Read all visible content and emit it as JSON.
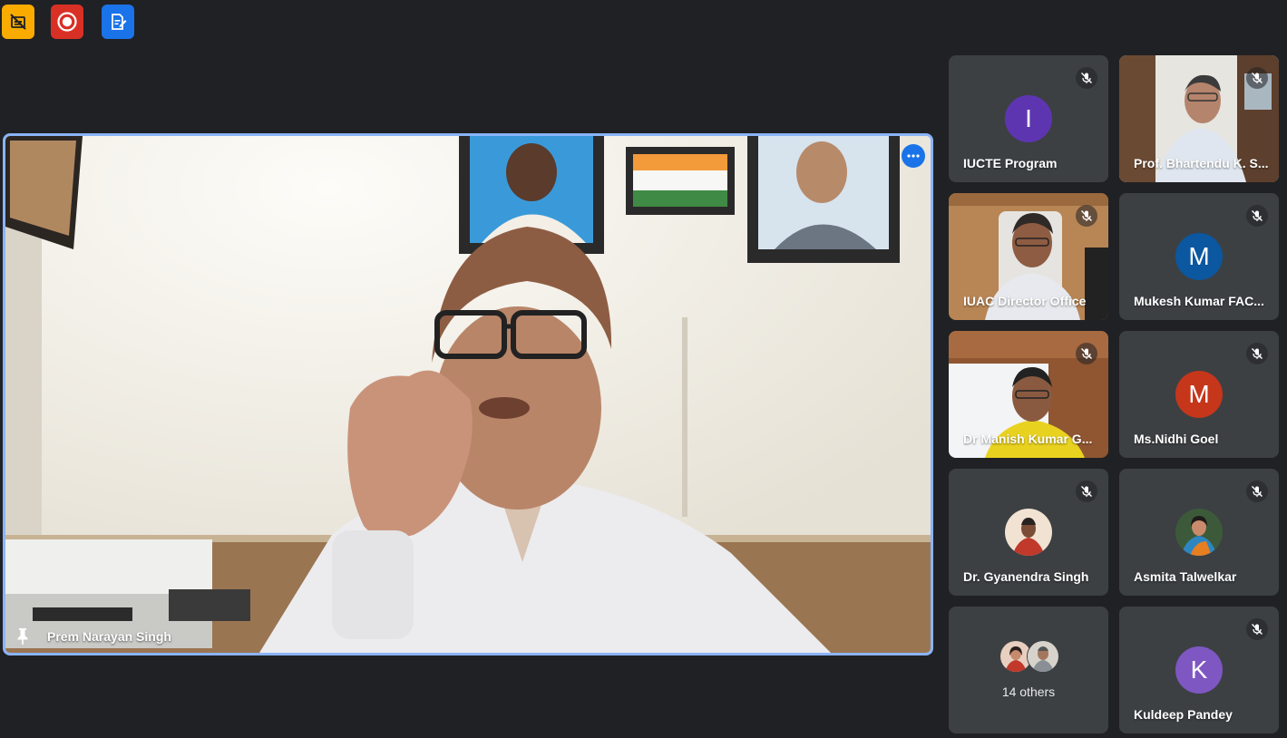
{
  "toolbar": {
    "captions_icon": "captions-off-icon",
    "record_icon": "recording-icon",
    "notes_icon": "notes-icon",
    "colors": {
      "captions": "#f9ab00",
      "record": "#d93025",
      "notes": "#1a73e8"
    }
  },
  "main": {
    "name": "Prem Narayan Singh",
    "pinned": true,
    "pin_icon": "pin-icon",
    "more_icon": "more-options-icon"
  },
  "participants": [
    {
      "name": "IUCTE Program",
      "type": "initial",
      "initial": "I",
      "color": "#5e35b1",
      "muted": true
    },
    {
      "name": "Prof. Bhartendu K. S...",
      "type": "video",
      "muted": true
    },
    {
      "name": "IUAC Director Office",
      "type": "video",
      "muted": true
    },
    {
      "name": "Mukesh Kumar FAC...",
      "type": "initial",
      "initial": "M",
      "color": "#0b57a0",
      "muted": true
    },
    {
      "name": "Dr Manish Kumar G...",
      "type": "video",
      "muted": true
    },
    {
      "name": "Ms.Nidhi Goel",
      "type": "initial",
      "initial": "M",
      "color": "#c5361b",
      "muted": true
    },
    {
      "name": "Dr. Gyanendra Singh",
      "type": "photo",
      "muted": true
    },
    {
      "name": "Asmita Talwelkar",
      "type": "photo",
      "muted": true
    },
    {
      "name": "14 others",
      "type": "others"
    },
    {
      "name": "Kuldeep Pandey",
      "type": "initial",
      "initial": "K",
      "color": "#7e57c2",
      "muted": true
    }
  ]
}
